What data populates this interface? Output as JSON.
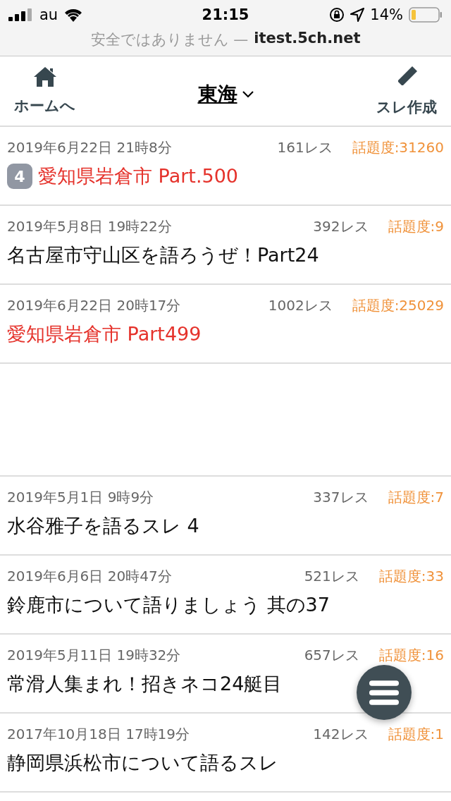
{
  "status_bar": {
    "carrier": "au",
    "time": "21:15",
    "battery": "14%"
  },
  "address_bar": {
    "security": "安全ではありません —",
    "domain": "itest.5ch.net"
  },
  "header": {
    "home_label": "ホームへ",
    "board": "東海",
    "create_label": "スレ作成"
  },
  "threads": [
    {
      "kind": "thread",
      "date": "2019年6月22日 21時8分",
      "replies": "161レス",
      "popularity": "話題度:31260",
      "title": "愛知県岩倉市 Part.500",
      "highlighted": true,
      "badge": "4"
    },
    {
      "kind": "thread",
      "date": "2019年5月8日 19時22分",
      "replies": "392レス",
      "popularity": "話題度:9",
      "title": "名古屋市守山区を語ろうぜ！Part24",
      "highlighted": false
    },
    {
      "kind": "thread",
      "date": "2019年6月22日 20時17分",
      "replies": "1002レス",
      "popularity": "話題度:25029",
      "title": "愛知県岩倉市 Part499",
      "highlighted": true
    },
    {
      "kind": "blank"
    },
    {
      "kind": "thread",
      "date": "2019年5月1日 9時9分",
      "replies": "337レス",
      "popularity": "話題度:7",
      "title": "水谷雅子を語るスレ 4",
      "highlighted": false
    },
    {
      "kind": "thread",
      "date": "2019年6月6日 20時47分",
      "replies": "521レス",
      "popularity": "話題度:33",
      "title": "鈴鹿市について語りましょう 其の37",
      "highlighted": false
    },
    {
      "kind": "thread",
      "date": "2019年5月11日 19時32分",
      "replies": "657レス",
      "popularity": "話題度:16",
      "title": "常滑人集まれ！招きネコ24艇目",
      "highlighted": false
    },
    {
      "kind": "thread",
      "date": "2017年10月18日 17時19分",
      "replies": "142レス",
      "popularity": "話題度:1",
      "title": "静岡県浜松市について語るスレ",
      "highlighted": false
    }
  ]
}
